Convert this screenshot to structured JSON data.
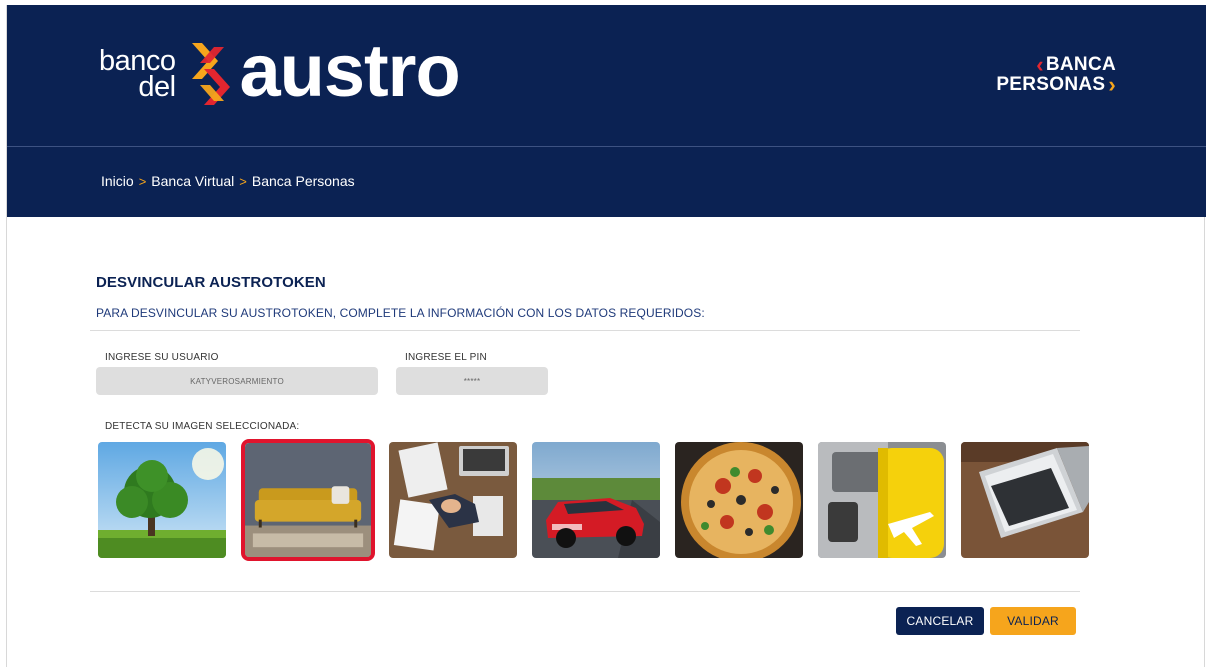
{
  "header": {
    "logo": {
      "word_small_1": "banco",
      "word_small_2": "del",
      "word_big": "austro"
    },
    "banca": {
      "line1": "BANCA",
      "line2": "PERSONAS"
    }
  },
  "breadcrumb": [
    "Inicio",
    "Banca Virtual",
    "Banca Personas"
  ],
  "form": {
    "title": "DESVINCULAR AUSTROTOKEN",
    "subtitle": "PARA DESVINCULAR SU AUSTROTOKEN, COMPLETE LA INFORMACIÓN CON LOS DATOS REQUERIDOS:",
    "user_label": "INGRESE SU USUARIO",
    "user_value": "KATYVEROSARMIENTO",
    "pin_label": "INGRESE EL PIN",
    "pin_value": "*****",
    "images_label": "DETECTA SU IMAGEN SELECCIONADA:"
  },
  "images": [
    {
      "name": "tree",
      "selected": false
    },
    {
      "name": "sofa",
      "selected": true
    },
    {
      "name": "office-handshake",
      "selected": false
    },
    {
      "name": "red-car",
      "selected": false
    },
    {
      "name": "pizza",
      "selected": false
    },
    {
      "name": "yellow-suitcase",
      "selected": false
    },
    {
      "name": "laptop",
      "selected": false
    }
  ],
  "buttons": {
    "cancel": "CANCELAR",
    "validate": "VALIDAR"
  },
  "colors": {
    "navy": "#0b2253",
    "orange": "#f6a51c",
    "red": "#e3262f",
    "selected_border": "#e0142d"
  }
}
